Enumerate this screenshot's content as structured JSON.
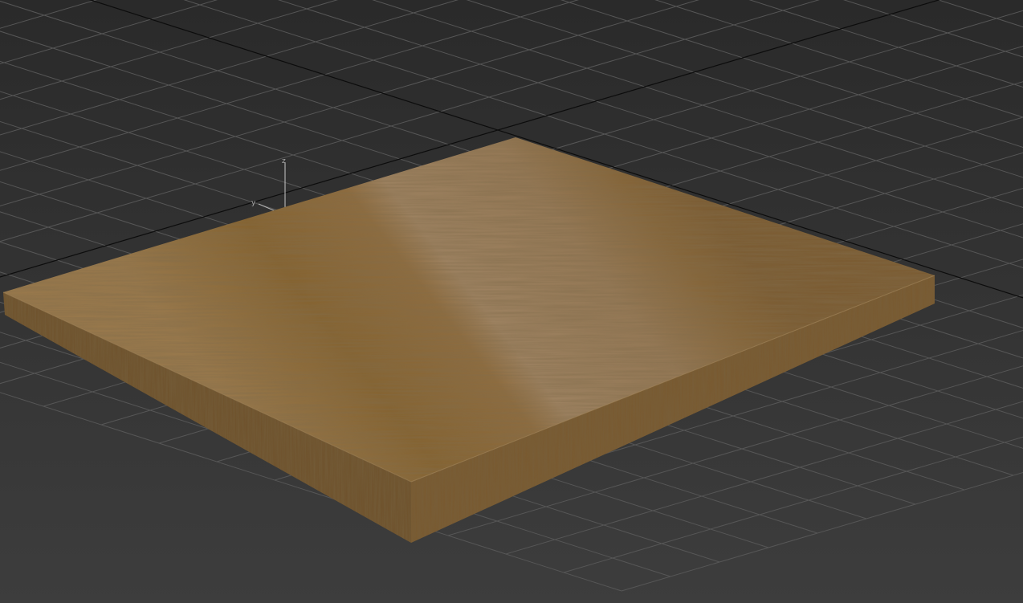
{
  "viewport": {
    "background_top": "#2a2a2a",
    "background_bottom": "#3d3d3d",
    "grid_color": "#565656",
    "world_axis_color": "#0c0c0c"
  },
  "gizmo": {
    "z_label": "z",
    "y_label": "y",
    "x_label": "x",
    "x_axis_color": "#e02a1f",
    "y_axis_color": "#b4b4b4",
    "z_axis_color": "#c8c8c8"
  },
  "object": {
    "material": "wood-plank",
    "top_color_light": "#9c7e59",
    "top_color_dark": "#7e5e32",
    "side_color": "#6a4d2a"
  }
}
